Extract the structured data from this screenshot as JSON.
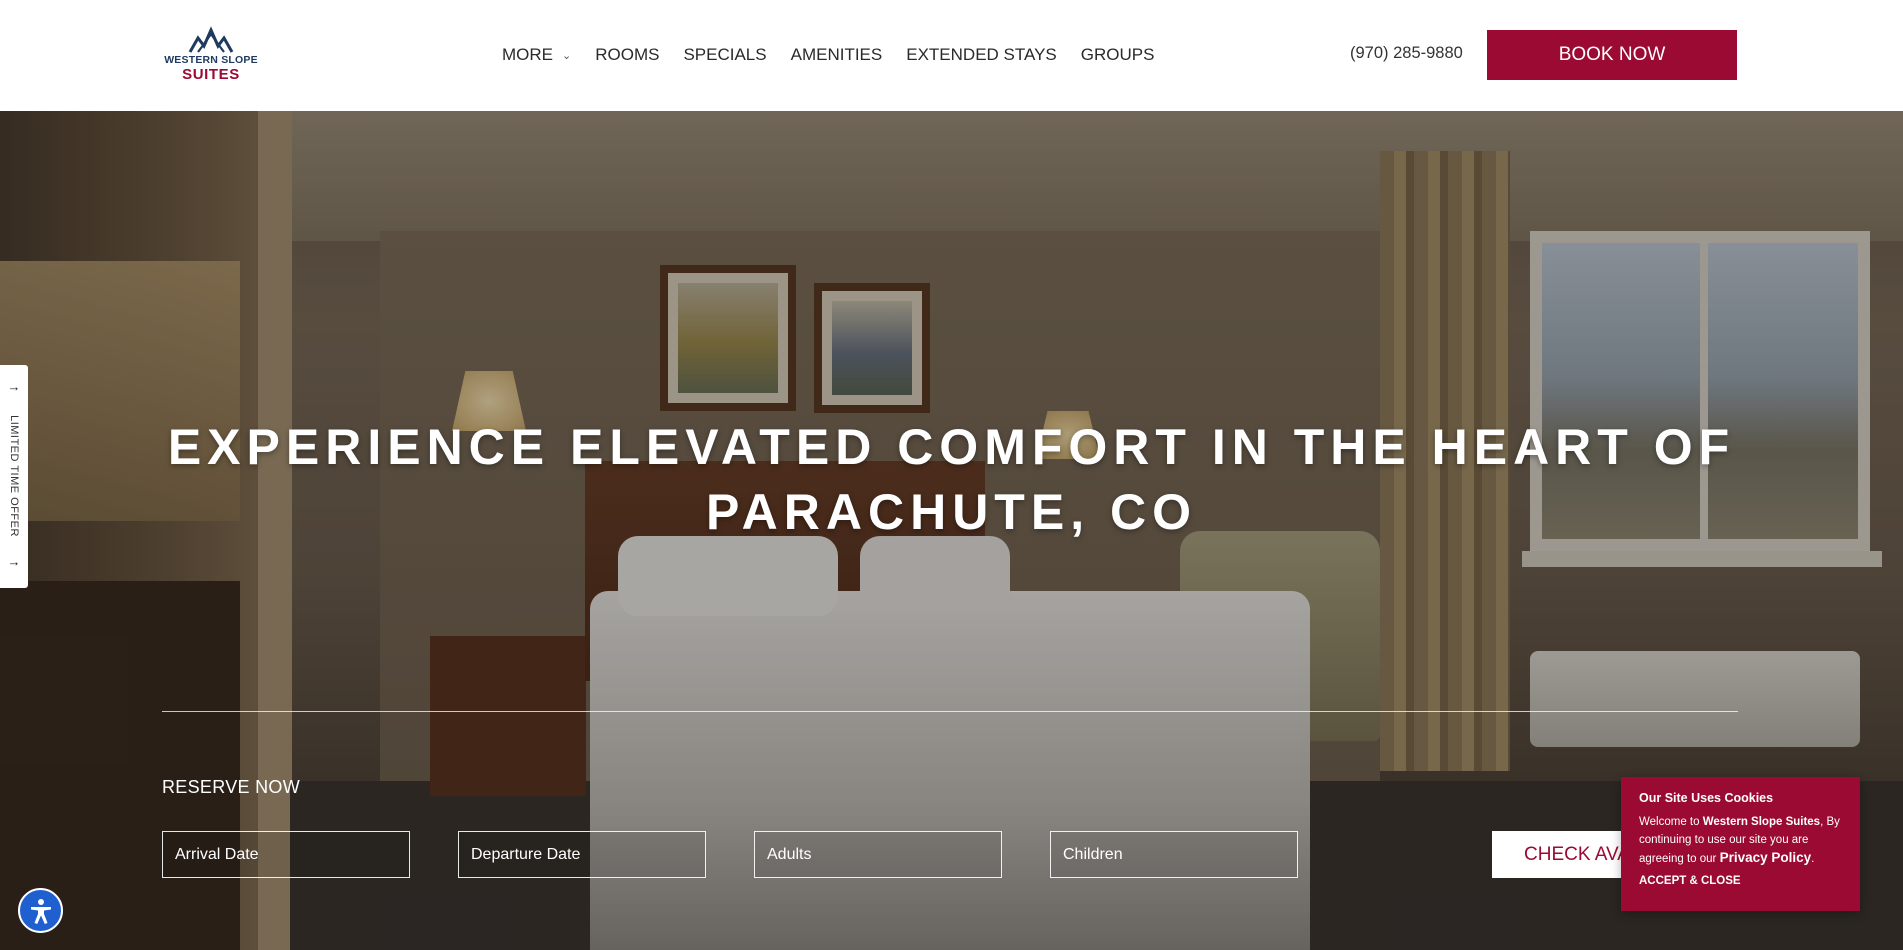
{
  "brand": {
    "logo_line1": "WESTERN SLOPE",
    "logo_line2": "SUITES",
    "colors": {
      "primary": "#9b0a32",
      "navy": "#1e3a5f",
      "accessibility": "#1f5fd0"
    }
  },
  "nav": {
    "items": [
      {
        "label": "MORE",
        "has_dropdown": true
      },
      {
        "label": "ROOMS"
      },
      {
        "label": "SPECIALS"
      },
      {
        "label": "AMENITIES"
      },
      {
        "label": "EXTENDED STAYS"
      },
      {
        "label": "GROUPS"
      }
    ],
    "phone": "(970) 285-9880",
    "book_label": "BOOK NOW"
  },
  "hero": {
    "title_line1": "EXPERIENCE ELEVATED COMFORT IN THE HEART OF",
    "title_line2": "PARACHUTE, CO"
  },
  "reserve": {
    "label": "RESERVE NOW",
    "fields": [
      {
        "placeholder": "Arrival Date"
      },
      {
        "placeholder": "Departure Date"
      },
      {
        "placeholder": "Adults"
      },
      {
        "placeholder": "Children"
      }
    ],
    "check_label": "CHECK AVAILABILITY"
  },
  "side_tab": {
    "label": "LIMITED TIME OFFER",
    "icon": "arrow-right-icon"
  },
  "accessibility": {
    "icon": "accessibility-icon"
  },
  "cookie": {
    "title": "Our Site Uses Cookies",
    "text_prefix": "Welcome to ",
    "brand": "Western Slope Suites",
    "text_mid": ", By continuing to use our site you are agreeing to our ",
    "policy_link": "Privacy Policy",
    "text_end": ".",
    "accept_label": "ACCEPT & CLOSE"
  }
}
